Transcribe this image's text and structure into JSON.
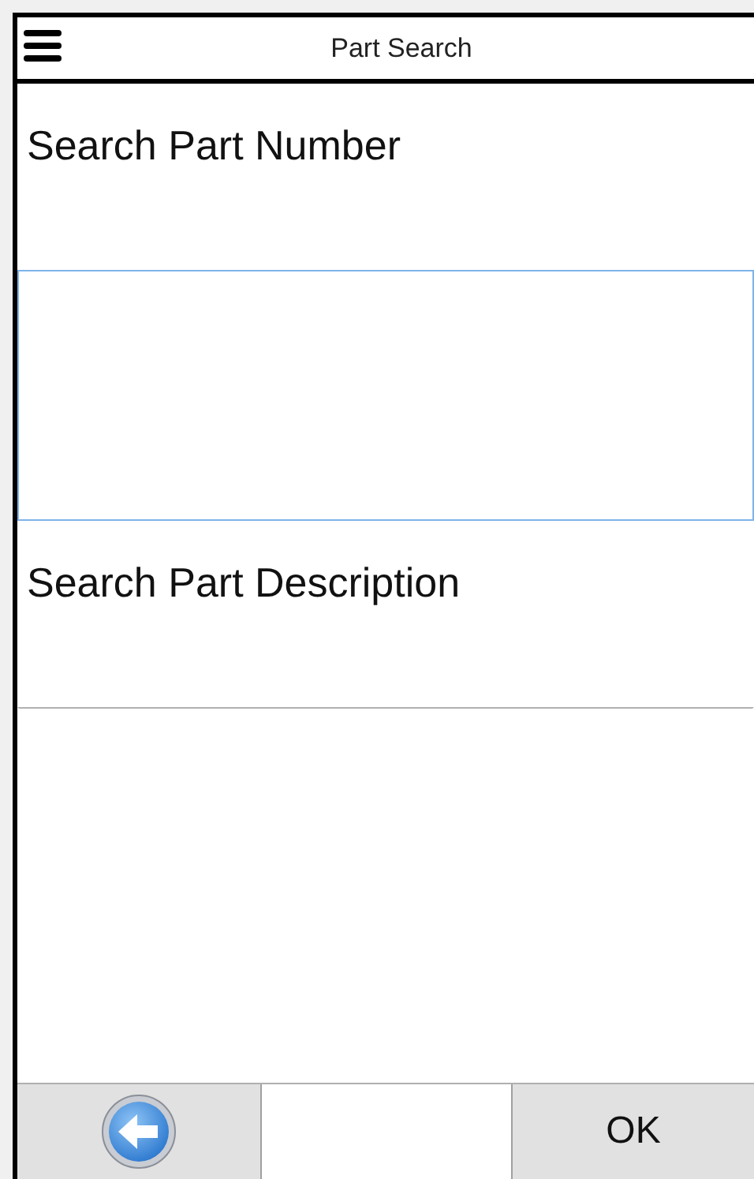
{
  "header": {
    "title": "Part Search"
  },
  "fields": [
    {
      "label": "Search Part Number",
      "focused": true
    },
    {
      "label": "Search Part Description",
      "focused": false
    }
  ],
  "footer": {
    "ok_label": "OK"
  }
}
